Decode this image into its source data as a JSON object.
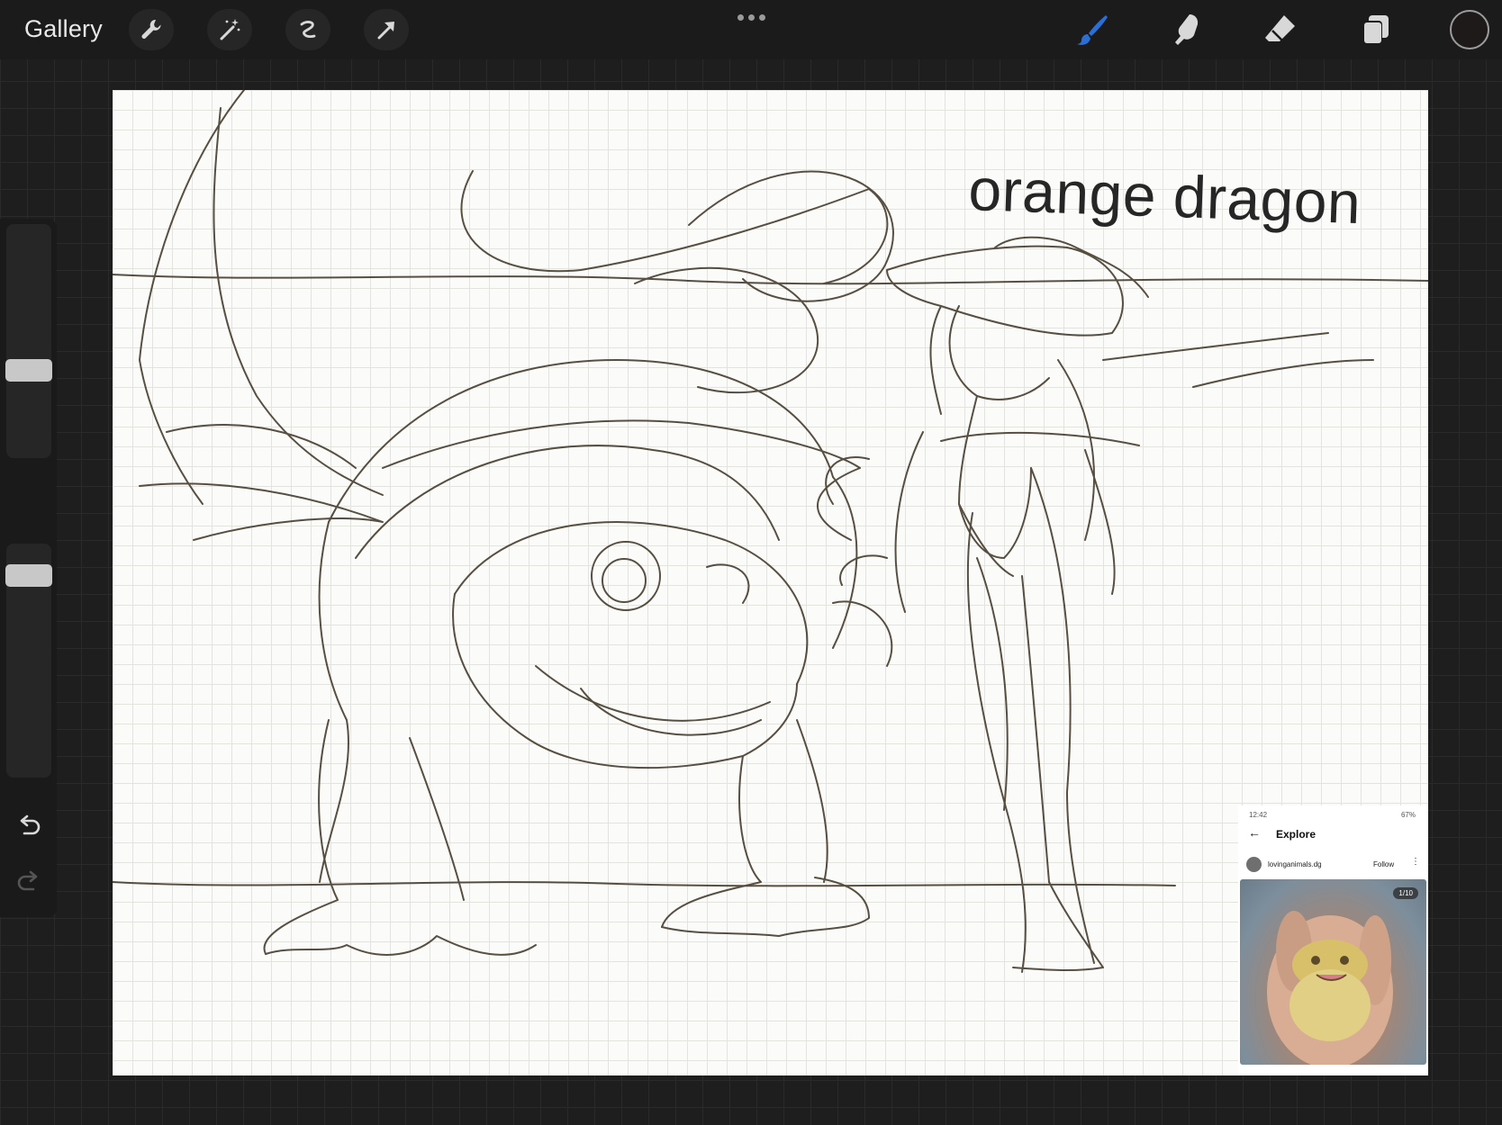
{
  "toolbar": {
    "gallery_label": "Gallery",
    "left_tools": [
      "wrench-icon",
      "magic-wand-icon",
      "selection-icon",
      "transform-arrow-icon"
    ],
    "right_tools": [
      "brush-icon",
      "smudge-icon",
      "eraser-icon",
      "layers-icon"
    ],
    "active_tool": "brush",
    "accent_color": "#2b6fd6",
    "current_color": "#1d1a19"
  },
  "sidebar": {
    "brush_size": 0.75,
    "opacity": 0.9
  },
  "canvas": {
    "title_text": "orange dragon",
    "ink_color": "#3b3222"
  },
  "reference": {
    "status_time": "12:42",
    "status_right": "67%",
    "screen_title": "Explore",
    "username": "lovinganimals.dg",
    "follow_label": "Follow",
    "image_counter": "1/10"
  }
}
